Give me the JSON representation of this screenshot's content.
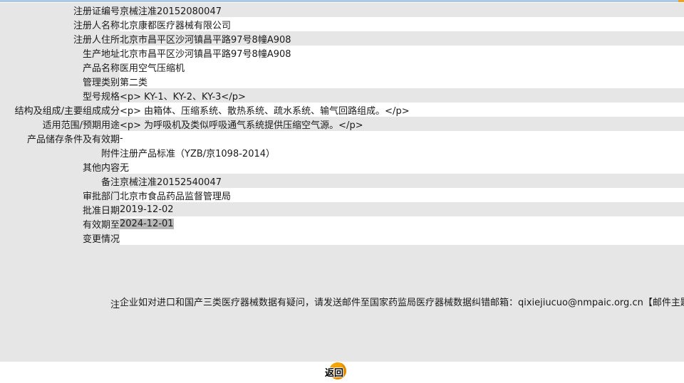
{
  "rows": [
    {
      "label": "注册证编号",
      "value": "京械注准20152080047"
    },
    {
      "label": "注册人名称",
      "value": "北京康都医疗器械有限公司"
    },
    {
      "label": "注册人住所",
      "value": "北京市昌平区沙河镇昌平路97号8幢A908"
    },
    {
      "label": "生产地址",
      "value": "北京市昌平区沙河镇昌平路97号8幢A908"
    },
    {
      "label": "产品名称",
      "value": "医用空气压缩机"
    },
    {
      "label": "管理类别",
      "value": "第二类"
    },
    {
      "label": "型号规格",
      "value": "<p> KY-1、KY-2、KY-3</p>"
    },
    {
      "label": "结构及组成/主要组成成分",
      "value": "<p> 由箱体、压缩系统、散热系统、疏水系统、输气回路组成。</p>"
    },
    {
      "label": "适用范围/预期用途",
      "value": "<p> 为呼吸机及类似呼吸通气系统提供压缩空气源。</p>"
    },
    {
      "label": "产品储存条件及有效期",
      "value": "-"
    },
    {
      "label": "附件",
      "value": "注册产品标准（YZB/京1098-2014）"
    },
    {
      "label": "其他内容",
      "value": "无"
    },
    {
      "label": "备注",
      "value": "京械注准20152540047"
    },
    {
      "label": "审批部门",
      "value": "北京市食品药品监督管理局"
    },
    {
      "label": "批准日期",
      "value": "2019-12-02"
    },
    {
      "label": "有效期至",
      "value": "2024-12-01"
    },
    {
      "label": "变更情况",
      "value": ""
    }
  ],
  "note": {
    "label": "注",
    "text": "企业如对进口和国产三类医疗器械数据有疑问，请发送邮件至国家药监局医疗器械数据纠错邮箱：qixiejiucuo@nmpaic.org.cn【邮件主题请注明“医疗器械数据问题”，邮件正文中请准确填写以下全部信息：1.医疗器械注册证号/备案号；2.类型（注册、变更、延续等）；3.问题描述（500字以内）；4.企业名称（全称）；5.统一社会信用代码；6.联系人姓名；7.联系电话（手机和座机）；8.联系邮箱】，或致电国家药监局医疗器械数据纠错电话010-88331514（此电话为我局医疗器械数据纠错联系电话，并非相应产品/企业业务咨询电话）。企业如对国产一类和二类医疗器械数据有疑问，请咨询国家局信息中心，电话010-88332877，88331520（工作日），也可通过发邮件与我们联系：邮件地址yaopinshuju@nmpaic.org.cn，邮件主题请注明“国产医疗器械产品（注册）-数据（注册证号/备案号）数据问题”。国产一类和二类医疗器械数据来源于省局，由省局通过数据共享平台进行纠错和维护。"
  },
  "back_button": {
    "label": "返回"
  },
  "colors": {
    "row_alt": "#e6e6e6",
    "top_bar": "#aac8e4",
    "button": "#f4a400"
  }
}
